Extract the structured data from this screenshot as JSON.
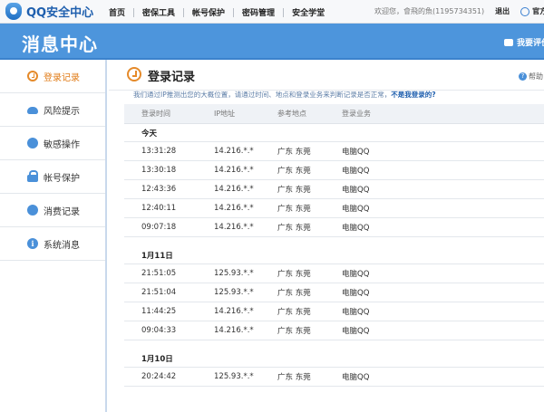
{
  "topbar": {
    "logo_text": "QQ安全中心",
    "nav": [
      "首页",
      "密保工具",
      "帐号保护",
      "密码管理",
      "安全学堂"
    ],
    "welcome": "欢迎您，",
    "username": "會飛的魚(1195734351)",
    "logout": "退出",
    "official": "官方订"
  },
  "header": {
    "title": "消息中心",
    "feedback": "我要评价"
  },
  "sidebar": {
    "items": [
      {
        "label": "登录记录",
        "icon": "clock-icon",
        "active": true
      },
      {
        "label": "风险提示",
        "icon": "cloud-icon"
      },
      {
        "label": "敏感操作",
        "icon": "smile-icon"
      },
      {
        "label": "帐号保护",
        "icon": "lock-icon"
      },
      {
        "label": "消费记录",
        "icon": "wallet-icon"
      },
      {
        "label": "系统消息",
        "icon": "info-icon"
      }
    ]
  },
  "main": {
    "title": "登录记录",
    "help": "帮助",
    "desc": "我们通过IP推测出您的大概位置，请通过时间、地点和登录业务来判断记录是否正常，",
    "desc_link": "不是我登录的?"
  },
  "table": {
    "headers": [
      "登录时间",
      "IP地址",
      "参考地点",
      "登录业务"
    ],
    "groups": [
      {
        "label": "今天",
        "rows": [
          [
            "13:31:28",
            "14.216.*.*",
            "广东 东莞",
            "电脑QQ"
          ],
          [
            "13:30:18",
            "14.216.*.*",
            "广东 东莞",
            "电脑QQ"
          ],
          [
            "12:43:36",
            "14.216.*.*",
            "广东 东莞",
            "电脑QQ"
          ],
          [
            "12:40:11",
            "14.216.*.*",
            "广东 东莞",
            "电脑QQ"
          ],
          [
            "09:07:18",
            "14.216.*.*",
            "广东 东莞",
            "电脑QQ"
          ]
        ]
      },
      {
        "label": "1月11日",
        "rows": [
          [
            "21:51:05",
            "125.93.*.*",
            "广东 东莞",
            "电脑QQ"
          ],
          [
            "21:51:04",
            "125.93.*.*",
            "广东 东莞",
            "电脑QQ"
          ],
          [
            "11:44:25",
            "14.216.*.*",
            "广东 东莞",
            "电脑QQ"
          ],
          [
            "09:04:33",
            "14.216.*.*",
            "广东 东莞",
            "电脑QQ"
          ]
        ]
      },
      {
        "label": "1月10日",
        "rows": [
          [
            "20:24:42",
            "125.93.*.*",
            "广东 东莞",
            "电脑QQ"
          ]
        ]
      }
    ]
  },
  "colors": {
    "header_blue": "#4d95dc",
    "accent_orange": "#e07b16",
    "link_blue": "#1f5fae"
  }
}
